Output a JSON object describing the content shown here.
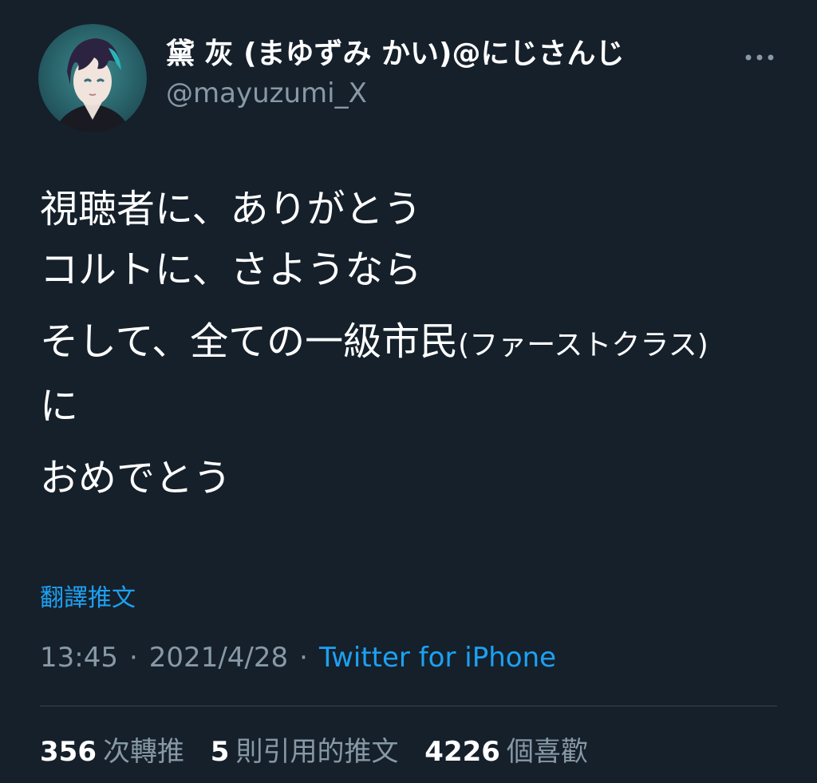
{
  "user": {
    "display_name": "黛 灰 (まゆずみ かい)@にじさんじ",
    "handle": "@mayuzumi_X"
  },
  "tweet": {
    "lines": [
      "視聴者に、ありがとう",
      "コルトに、さようなら",
      "そして、全ての一級市民",
      "(ファーストクラス)",
      "に",
      "おめでとう"
    ]
  },
  "translate_label": "翻譯推文",
  "meta": {
    "time": "13:45",
    "date": "2021/4/28",
    "separator": "·",
    "source": "Twitter for iPhone"
  },
  "stats": {
    "retweets": "356",
    "retweets_label": "次轉推",
    "quotes": "5",
    "quotes_label": "則引用的推文",
    "likes": "4226",
    "likes_label": "個喜歡"
  },
  "colors": {
    "background": "#15202b",
    "link": "#1da1f2",
    "secondary_text": "#8899a6",
    "divider": "#38444d"
  },
  "icons": {
    "more": "more-horizontal-icon",
    "avatar": "avatar"
  }
}
